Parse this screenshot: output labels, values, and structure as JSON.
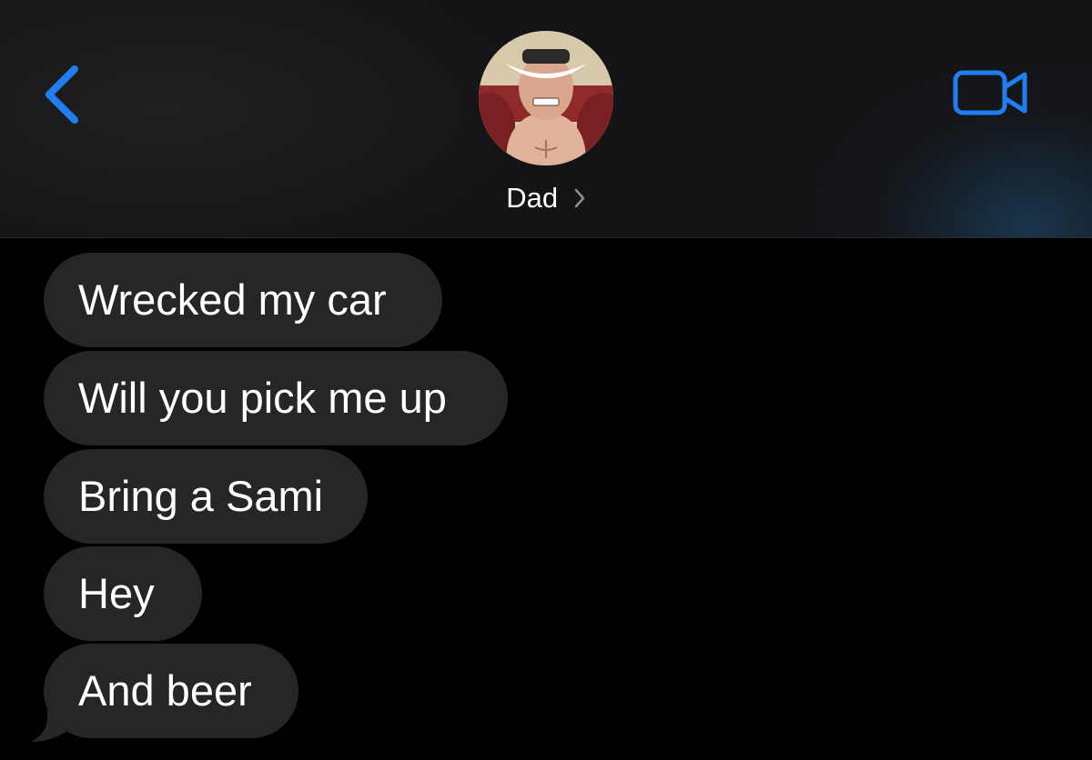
{
  "header": {
    "contact_name": "Dad",
    "icons": {
      "back": "chevron-left-icon",
      "video": "video-camera-icon",
      "name_chevron": "chevron-right-icon"
    },
    "accent_color": "#1f7ef2"
  },
  "messages": [
    {
      "sender": "contact",
      "text": "Wrecked my car"
    },
    {
      "sender": "contact",
      "text": "Will you pick me up"
    },
    {
      "sender": "contact",
      "text": "Bring a Sami"
    },
    {
      "sender": "contact",
      "text": "Hey"
    },
    {
      "sender": "contact",
      "text": "And beer"
    }
  ],
  "colors": {
    "background": "#000000",
    "header_background": "#141416",
    "incoming_bubble": "#262628",
    "text": "#ffffff"
  }
}
